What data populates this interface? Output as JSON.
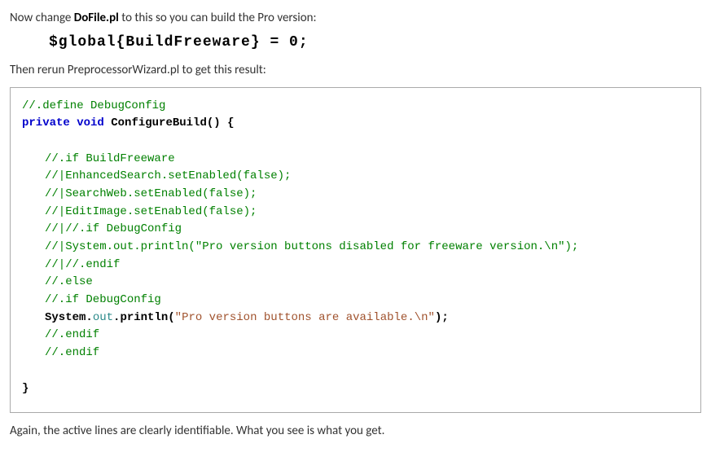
{
  "intro": {
    "before_bold": "Now change ",
    "bold": "DoFile.pl",
    "after_bold": " to this so you can build the Pro version:"
  },
  "global_line": "$global{BuildFreeware} = 0;",
  "rerun": "Then rerun PreprocessorWizard.pl to get this result:",
  "code": {
    "l1": "//.define DebugConfig",
    "l2a": "private",
    "l2b": "void",
    "l2c": "ConfigureBuild",
    "l2d": "() {",
    "l3": "//.if BuildFreeware",
    "l4": "//|EnhancedSearch.setEnabled(false);",
    "l5": "//|SearchWeb.setEnabled(false);",
    "l6": "//|EditImage.setEnabled(false);",
    "l7": "//|//.if DebugConfig",
    "l8": "//|System.out.println(\"Pro version buttons disabled for freeware version.\\n\");",
    "l9": "//|//.endif",
    "l10": "//.else",
    "l11": "//.if DebugConfig",
    "l12a": "System",
    "l12b": ".",
    "l12c": "out",
    "l12d": ".",
    "l12e": "println",
    "l12f": "(",
    "l12g": "\"Pro version buttons are available.\\n\"",
    "l12h": ");",
    "l13": "//.endif",
    "l14": "//.endif",
    "l15": "}"
  },
  "outro": "Again, the active lines are clearly identifiable.  What you see is what you get."
}
